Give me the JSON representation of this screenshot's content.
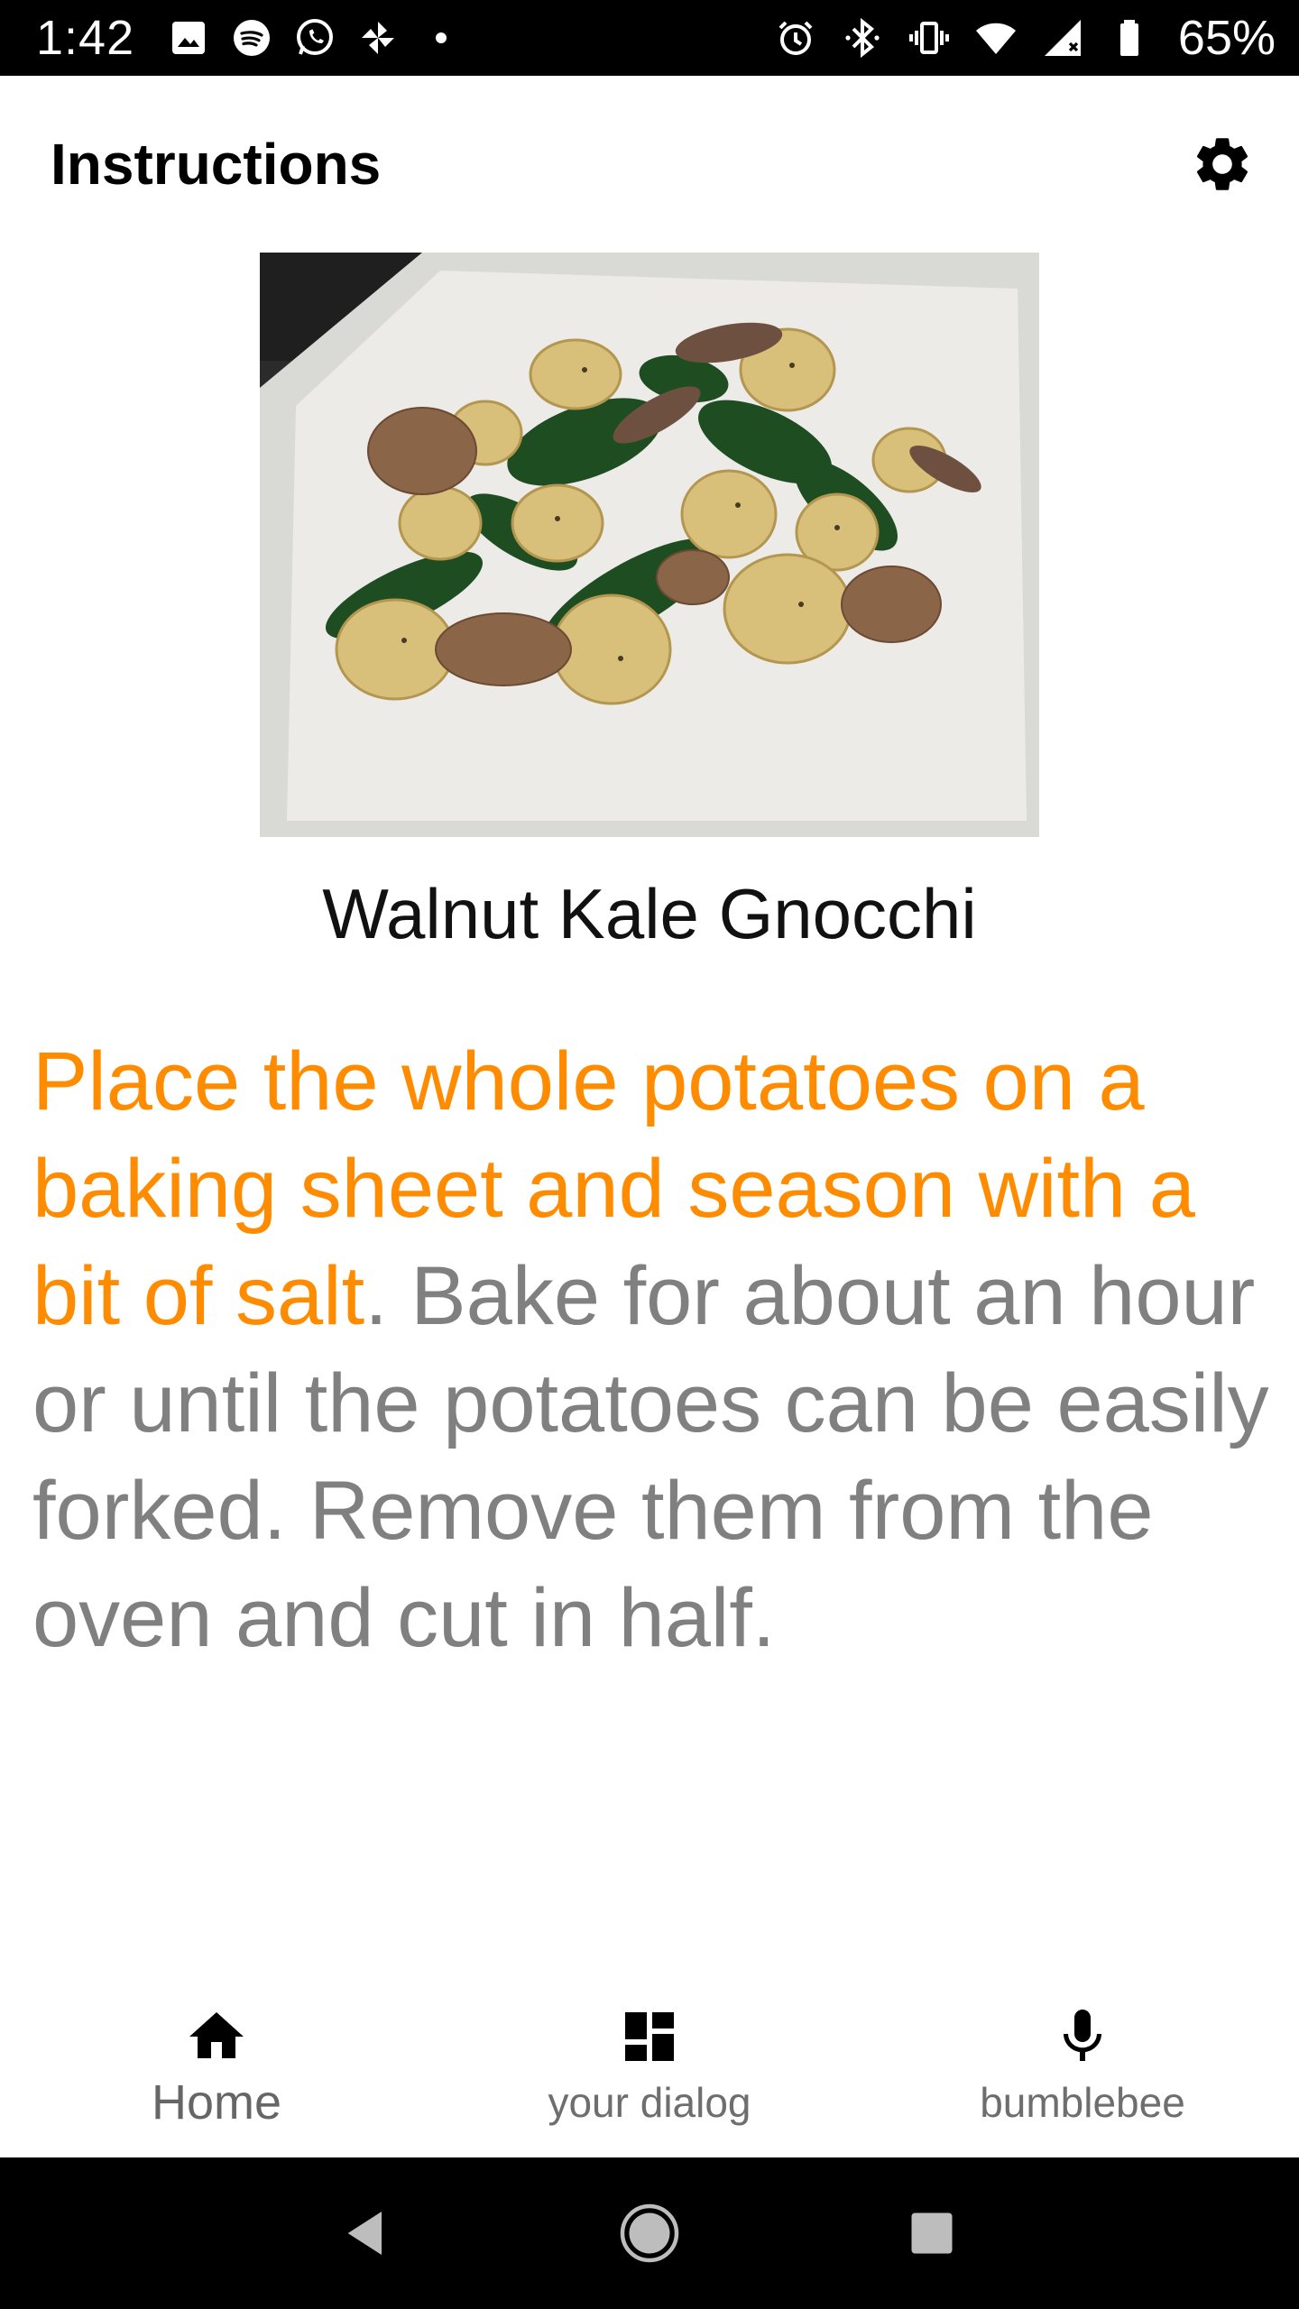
{
  "status_bar": {
    "time": "1:42",
    "battery_percent": "65%",
    "left_icons": [
      "gallery-icon",
      "spotify-icon",
      "whatsapp-icon",
      "pinwheel-icon",
      "dot-icon"
    ],
    "right_icons": [
      "alarm-icon",
      "bluetooth-icon",
      "vibrate-icon",
      "wifi-icon",
      "cellular-icon",
      "battery-icon"
    ]
  },
  "app_bar": {
    "title": "Instructions",
    "settings_icon": "gear-icon"
  },
  "recipe": {
    "title": "Walnut Kale Gnocchi",
    "instruction_highlight": "Place the whole potatoes on a baking sheet and season with a bit of salt",
    "instruction_rest": ". Bake for about an hour or until the potatoes can be easily forked. Remove them from the oven and cut in half."
  },
  "bottom_nav": {
    "items": [
      {
        "label": "Home",
        "icon": "home-icon"
      },
      {
        "label": "your dialog",
        "icon": "dashboard-icon"
      },
      {
        "label": "bumblebee",
        "icon": "microphone-icon"
      }
    ]
  },
  "colors": {
    "highlight": "#ff8c00",
    "body_text": "#808080",
    "status_bar_bg": "#000000"
  }
}
